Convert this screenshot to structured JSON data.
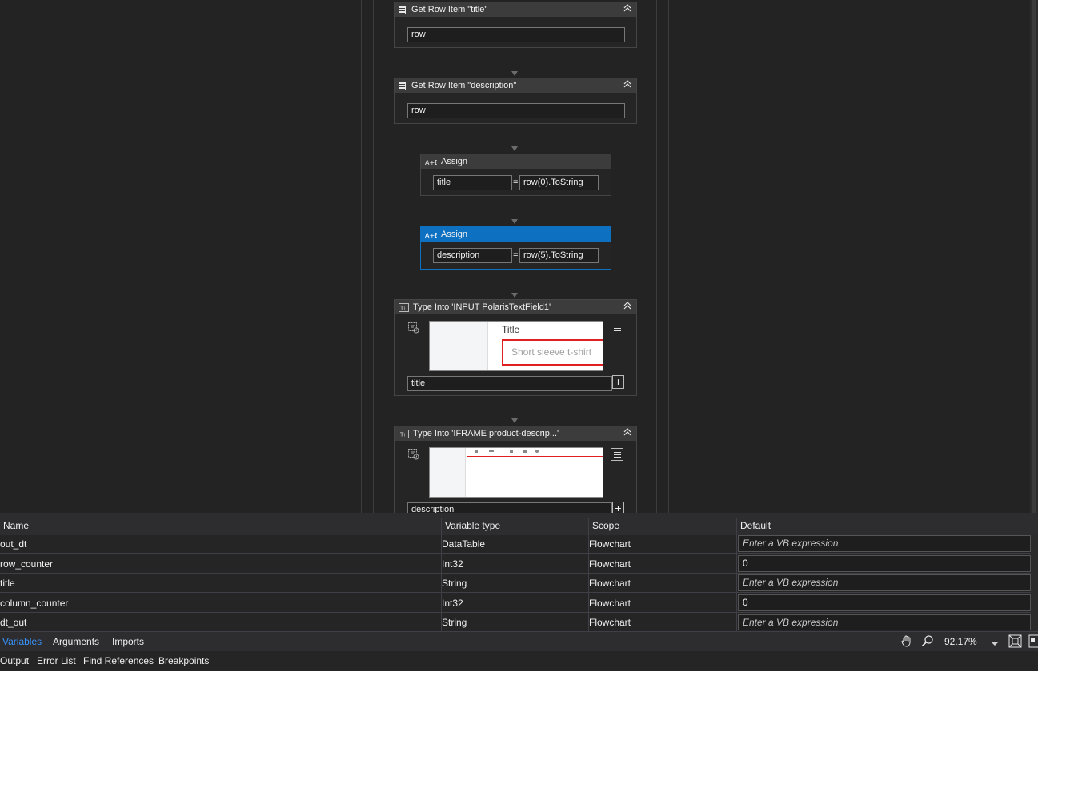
{
  "activities": {
    "get_title": {
      "label": "Get Row Item \"title\"",
      "row": "row"
    },
    "get_description": {
      "label": "Get Row Item \"description\"",
      "row": "row"
    },
    "assign1": {
      "label": "Assign",
      "to": "title",
      "value": "row(0).ToString"
    },
    "assign2": {
      "label": "Assign",
      "to": "description",
      "value": "row(5).ToString"
    },
    "type1": {
      "label": "Type Into 'INPUT  PolarisTextField1'",
      "preview_title": "Title",
      "preview_text": "Short sleeve t-shirt",
      "text": "title"
    },
    "type2": {
      "label": "Type Into 'IFRAME  product-descrip...'",
      "text": "description"
    }
  },
  "variables": {
    "columns": [
      "Name",
      "Variable type",
      "Scope",
      "Default"
    ],
    "rows": [
      {
        "name": "out_dt",
        "type": "DataTable",
        "scope": "Flowchart",
        "default": "Enter a VB expression",
        "placeholder": true
      },
      {
        "name": "row_counter",
        "type": "Int32",
        "scope": "Flowchart",
        "default": "0",
        "placeholder": false
      },
      {
        "name": "title",
        "type": "String",
        "scope": "Flowchart",
        "default": "Enter a VB expression",
        "placeholder": true
      },
      {
        "name": "column_counter",
        "type": "Int32",
        "scope": "Flowchart",
        "default": "0",
        "placeholder": false
      },
      {
        "name": "dt_out",
        "type": "String",
        "scope": "Flowchart",
        "default": "Enter a VB expression",
        "placeholder": true
      }
    ]
  },
  "panel_tabs": {
    "variables": "Variables",
    "arguments": "Arguments",
    "imports": "Imports"
  },
  "zoom": "92.17%",
  "bottom_tabs": {
    "output": "Output",
    "error_list": "Error List",
    "find_references": "Find References",
    "breakpoints": "Breakpoints"
  },
  "colors": {
    "selected": "#0e70c0",
    "active_tab": "#3794ff",
    "highlight_box": "#e02020"
  },
  "icons": [
    "table-icon",
    "assign-icon",
    "type-into-icon",
    "collapse-icon",
    "target-icon",
    "menu-icon",
    "plus-icon",
    "hand-icon",
    "zoom-icon",
    "fit-screen-icon",
    "overview-icon"
  ]
}
